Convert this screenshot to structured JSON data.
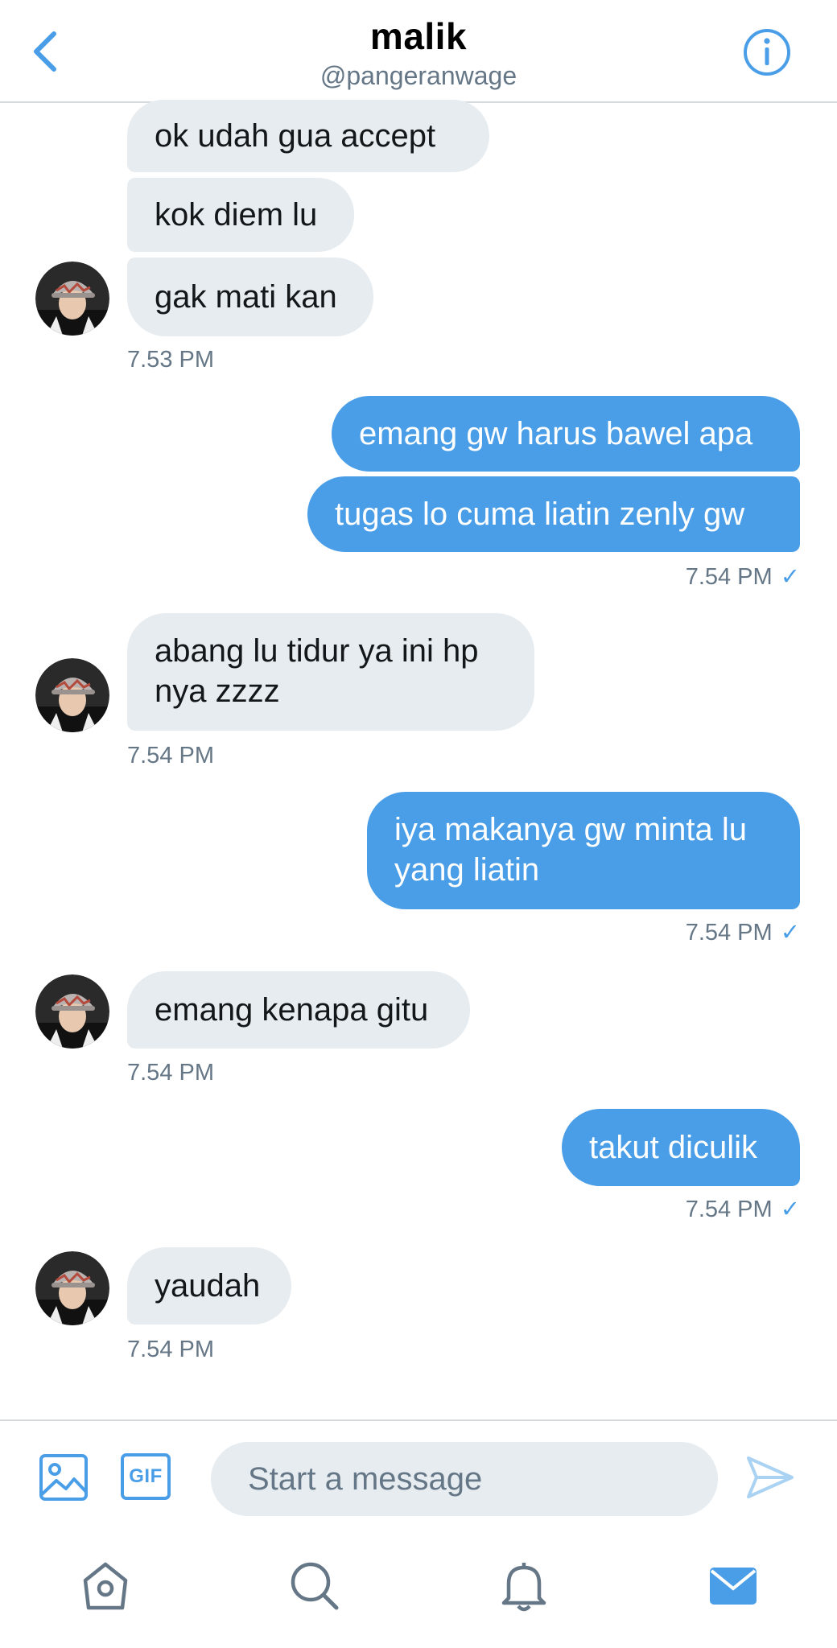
{
  "header": {
    "title": "malik",
    "handle": "@pangeranwage"
  },
  "messages": [
    {
      "side": "in",
      "text": "ok udah gua accept"
    },
    {
      "side": "in",
      "text": "kok diem lu"
    },
    {
      "side": "in",
      "text": "gak mati kan"
    },
    {
      "side": "in",
      "time": "7.53 PM"
    },
    {
      "side": "out",
      "text": "emang gw harus bawel apa"
    },
    {
      "side": "out",
      "text": "tugas lo cuma liatin zenly gw"
    },
    {
      "side": "out",
      "time": "7.54 PM",
      "check": "✓"
    },
    {
      "side": "in",
      "text_line1": "abang lu tidur ya ini hp",
      "text_line2": "nya zzzz"
    },
    {
      "side": "in",
      "time": "7.54 PM"
    },
    {
      "side": "out",
      "text_line1": "iya makanya gw minta lu",
      "text_line2": "yang liatin"
    },
    {
      "side": "out",
      "time": "7.54 PM",
      "check": "✓"
    },
    {
      "side": "in",
      "text": "emang kenapa gitu"
    },
    {
      "side": "in",
      "time": "7.54 PM"
    },
    {
      "side": "out",
      "text": "takut diculik"
    },
    {
      "side": "out",
      "time": "7.54 PM",
      "check": "✓"
    },
    {
      "side": "in",
      "text": "yaudah"
    },
    {
      "side": "in",
      "time": "7.54 PM"
    }
  ],
  "composer": {
    "placeholder": "Start a message",
    "gif_label": "GIF"
  },
  "tabbar": {
    "items": [
      "home-icon",
      "search-icon",
      "bell-icon",
      "mail-icon"
    ],
    "active": "mail-icon"
  },
  "colors": {
    "accent": "#4a9ee8",
    "incoming_bubble": "#e6ecf0",
    "secondary_text": "#657786"
  }
}
